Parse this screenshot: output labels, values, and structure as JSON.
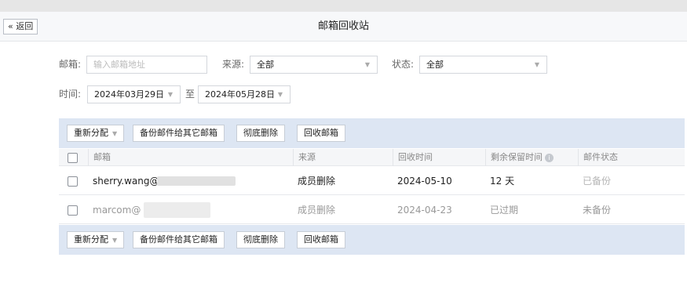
{
  "header": {
    "back_label": "« 返回",
    "title": "邮箱回收站"
  },
  "filters": {
    "mailbox_label": "邮箱:",
    "mailbox_placeholder": "输入邮箱地址",
    "source_label": "来源:",
    "source_value": "全部",
    "status_label": "状态:",
    "status_value": "全部",
    "time_label": "时间:",
    "date_from": "2024年03月29日",
    "date_sep": "至",
    "date_to": "2024年05月28日"
  },
  "toolbar": {
    "reassign": "重新分配",
    "backup": "备份邮件给其它邮箱",
    "delete": "彻底删除",
    "recover": "回收邮箱"
  },
  "table": {
    "headers": [
      "邮箱",
      "来源",
      "回收时间",
      "剩余保留时间",
      "邮件状态"
    ],
    "rows": [
      {
        "email": "sherry.wang@",
        "source": "成员删除",
        "time": "2024-05-10",
        "remaining": "12 天",
        "status": "已备份"
      },
      {
        "email": "marcom@",
        "source": "成员删除",
        "time": "2024-04-23",
        "remaining": "已过期",
        "status": "未备份"
      }
    ]
  },
  "icons": {
    "dropdown": "caret-down-icon",
    "info": "info-icon"
  }
}
